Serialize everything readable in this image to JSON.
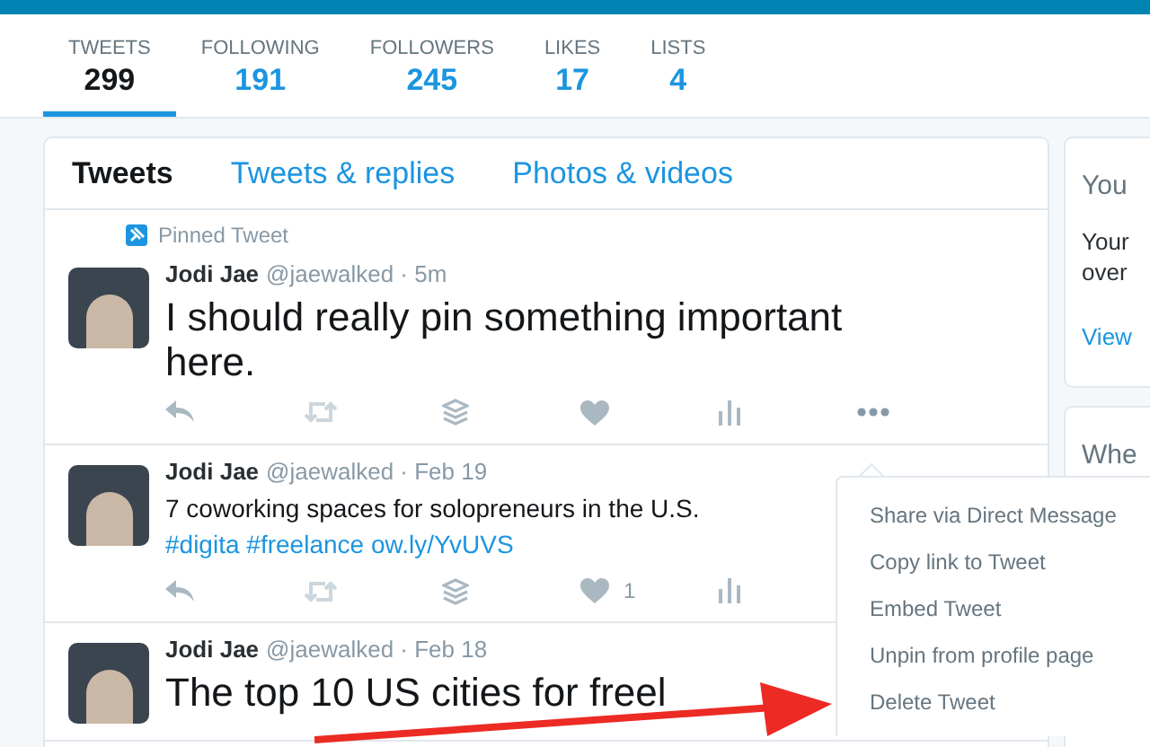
{
  "profile_nav": [
    {
      "label": "TWEETS",
      "count": "299",
      "selected": true
    },
    {
      "label": "FOLLOWING",
      "count": "191",
      "selected": false
    },
    {
      "label": "FOLLOWERS",
      "count": "245",
      "selected": false
    },
    {
      "label": "LIKES",
      "count": "17",
      "selected": false
    },
    {
      "label": "LISTS",
      "count": "4",
      "selected": false
    }
  ],
  "timeline_tabs": [
    {
      "label": "Tweets",
      "selected": true
    },
    {
      "label": "Tweets & replies",
      "selected": false
    },
    {
      "label": "Photos & videos",
      "selected": false
    }
  ],
  "tweets": [
    {
      "pinned_label": "Pinned Tweet",
      "name": "Jodi Jae",
      "handle": "@jaewalked · 5m",
      "kind": "large",
      "text": [
        {
          "kind": "plain",
          "text": "I should really pin something important here."
        }
      ]
    },
    {
      "name": "Jodi Jae",
      "handle": "@jaewalked · Feb 19",
      "kind": "normal",
      "text": [
        {
          "kind": "plain",
          "text": "7 coworking spaces for solopreneurs in the U.S. "
        },
        {
          "kind": "link",
          "text": "#digita"
        },
        {
          "kind": "link",
          "text": "#freelance"
        },
        {
          "kind": "link",
          "text": "ow.ly/YvUVS"
        }
      ],
      "like_count": "1"
    },
    {
      "name": "Jodi Jae",
      "handle": "@jaewalked · Feb 18",
      "kind": "large",
      "text": [
        {
          "kind": "plain",
          "text": "The top 10 US cities for freel"
        }
      ]
    }
  ],
  "tweet_menu": {
    "items": [
      "Share via Direct Message",
      "Copy link to Tweet",
      "Embed Tweet",
      "Unpin from profile page",
      "Delete Tweet"
    ]
  },
  "sidebar_cards": [
    {
      "title": "You",
      "body": [
        "Your",
        "over"
      ],
      "link": "View"
    },
    {
      "title": "Whe"
    }
  ]
}
